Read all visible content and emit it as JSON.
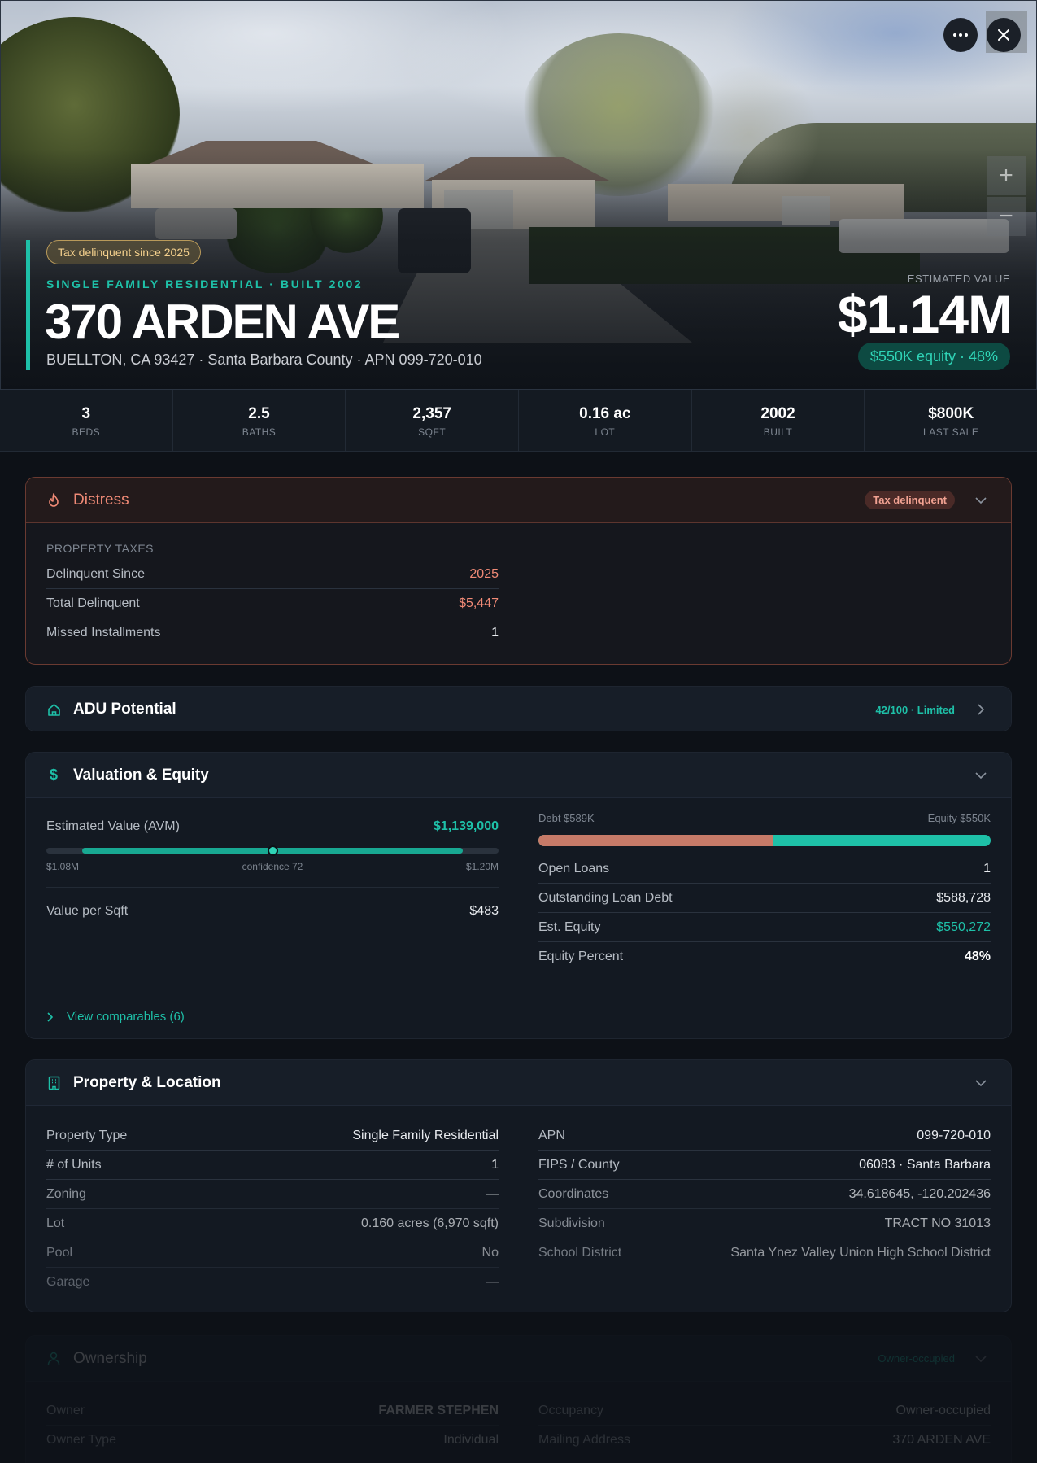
{
  "hero": {
    "badge": "Tax delinquent since 2025",
    "subtitle": "SINGLE FAMILY RESIDENTIAL · BUILT 2002",
    "title": "370 ARDEN AVE",
    "address": "BUELLTON, CA 93427 · Santa Barbara County · APN 099-720-010",
    "estimated_label": "ESTIMATED VALUE",
    "estimated_value": "$1.14M",
    "equity_pill": "$550K equity · 48%",
    "controls": {
      "more": "more-icon",
      "close": "close-icon",
      "zoom_in": "+",
      "zoom_out": "−"
    }
  },
  "stats": [
    {
      "value": "3",
      "label": "BEDS"
    },
    {
      "value": "2.5",
      "label": "BATHS"
    },
    {
      "value": "2,357",
      "label": "SQFT"
    },
    {
      "value": "0.16 ac",
      "label": "LOT"
    },
    {
      "value": "2002",
      "label": "BUILT"
    },
    {
      "value": "$800K",
      "label": "LAST SALE"
    }
  ],
  "distress": {
    "title": "Distress",
    "badge": "Tax delinquent",
    "section_label": "PROPERTY TAXES",
    "rows": [
      {
        "k": "Delinquent Since",
        "v": "2025"
      },
      {
        "k": "Total Delinquent",
        "v": "$5,447"
      },
      {
        "k": "Missed Installments",
        "v": "1"
      }
    ]
  },
  "adu": {
    "title": "ADU Potential",
    "score": "42/100 · Limited"
  },
  "valuation": {
    "title": "Valuation & Equity",
    "avm_label": "Estimated Value (AVM)",
    "avm_value": "$1,139,000",
    "avm_low": "$1.08M",
    "avm_confidence": "confidence 72",
    "avm_high": "$1.20M",
    "avm_range_fraction": {
      "start": 0.08,
      "end": 0.92,
      "point": 0.5
    },
    "value_per_sqft_label": "Value per Sqft",
    "value_per_sqft": "$483",
    "debt_label": "Debt $589K",
    "equity_label": "Equity $550K",
    "debt_fraction": 0.52,
    "rows": [
      {
        "k": "Open Loans",
        "v": "1"
      },
      {
        "k": "Outstanding Loan Debt",
        "v": "$588,728"
      },
      {
        "k": "Est. Equity",
        "v": "$550,272"
      },
      {
        "k": "Equity Percent",
        "v": "48%"
      }
    ],
    "comparables_link": "View comparables (6)"
  },
  "property": {
    "title": "Property & Location",
    "left": [
      {
        "k": "Property Type",
        "v": "Single Family Residential"
      },
      {
        "k": "# of Units",
        "v": "1"
      },
      {
        "k": "Zoning",
        "v": "—"
      },
      {
        "k": "Lot",
        "v": "0.160 acres (6,970 sqft)"
      },
      {
        "k": "Pool",
        "v": "No"
      },
      {
        "k": "Garage",
        "v": "—"
      }
    ],
    "right": [
      {
        "k": "APN",
        "v": "099-720-010"
      },
      {
        "k": "FIPS / County",
        "v": "06083 · Santa Barbara"
      },
      {
        "k": "Coordinates",
        "v": "34.618645, -120.202436"
      },
      {
        "k": "Subdivision",
        "v": "TRACT NO 31013"
      },
      {
        "k": "School District",
        "v": "Santa Ynez Valley Union High School District"
      }
    ]
  },
  "ownership": {
    "title": "Ownership",
    "badge": "Owner-occupied",
    "left": [
      {
        "k": "Owner",
        "v": "FARMER STEPHEN"
      },
      {
        "k": "Owner Type",
        "v": "Individual"
      }
    ],
    "right": [
      {
        "k": "Occupancy",
        "v": "Owner-occupied"
      },
      {
        "k": "Mailing Address",
        "v": "370 ARDEN AVE"
      }
    ]
  },
  "colors": {
    "accent": "#1ec0a8",
    "danger": "#f08a76",
    "debt": "#c67a68",
    "background": "#0d1117"
  }
}
